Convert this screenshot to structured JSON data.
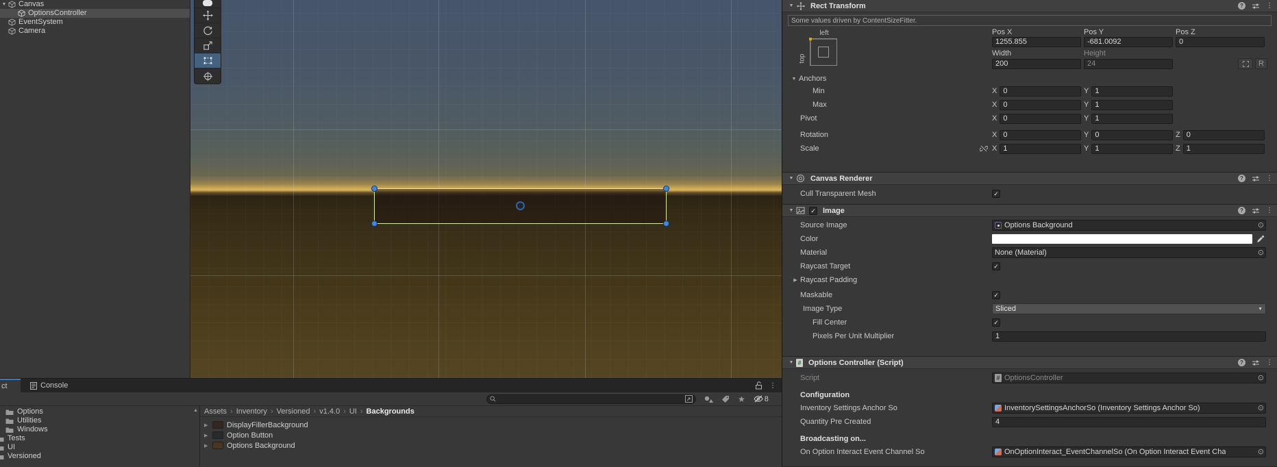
{
  "hierarchy": {
    "items": [
      {
        "label": "Canvas"
      },
      {
        "label": "OptionsController"
      },
      {
        "label": "EventSystem"
      },
      {
        "label": "Camera"
      }
    ]
  },
  "inspector": {
    "axis": {
      "x": "X",
      "y": "Y",
      "z": "Z"
    },
    "rect_transform": {
      "title": "Rect Transform",
      "info": "Some values driven by ContentSizeFitter.",
      "anchor_h": "left",
      "anchor_v": "top",
      "pos_x_label": "Pos X",
      "pos_x": "1255.855",
      "pos_y_label": "Pos Y",
      "pos_y": "-681.0092",
      "pos_z_label": "Pos Z",
      "pos_z": "0",
      "width_label": "Width",
      "width": "200",
      "height_label": "Height",
      "height": "24",
      "raw_button": "R",
      "anchors_label": "Anchors",
      "min_label": "Min",
      "min_x": "0",
      "min_y": "1",
      "max_label": "Max",
      "max_x": "0",
      "max_y": "1",
      "pivot_label": "Pivot",
      "pivot_x": "0",
      "pivot_y": "1",
      "rotation_label": "Rotation",
      "rotation_x": "0",
      "rotation_y": "0",
      "rotation_z": "0",
      "scale_label": "Scale",
      "scale_x": "1",
      "scale_y": "1",
      "scale_z": "1"
    },
    "canvas_renderer": {
      "title": "Canvas Renderer",
      "cull_label": "Cull Transparent Mesh"
    },
    "image": {
      "title": "Image",
      "source_label": "Source Image",
      "source_value": "Options Background",
      "color_label": "Color",
      "material_label": "Material",
      "material_value": "None (Material)",
      "raycast_target_label": "Raycast Target",
      "raycast_padding_label": "Raycast Padding",
      "maskable_label": "Maskable",
      "type_label": "Image Type",
      "type_value": "Sliced",
      "fill_center_label": "Fill Center",
      "ppu_label": "Pixels Per Unit Multiplier",
      "ppu_value": "1"
    },
    "options_controller": {
      "title": "Options Controller (Script)",
      "script_label": "Script",
      "script_value": "OptionsController",
      "config_header": "Configuration",
      "anchor_so_label": "Inventory Settings Anchor So",
      "anchor_so_value": "InventorySettingsAnchorSo (Inventory Settings Anchor So)",
      "quantity_label": "Quantity Pre Created",
      "quantity_value": "4",
      "broadcast_header": "Broadcasting on...",
      "event_label": "On Option Interact Event Channel So",
      "event_value": "OnOptionInteract_EventChannelSo (On Option Interact Event Cha"
    }
  },
  "bottom_panel": {
    "tab_partial": "ct",
    "tab_console": "Console",
    "hidden_count": "8",
    "breadcrumb_sep": "›",
    "folders": [
      "Options",
      "Utilities",
      "Windows",
      "Tests",
      "UI",
      "Versioned"
    ],
    "breadcrumb": [
      "Assets",
      "Inventory",
      "Versioned",
      "v1.4.0",
      "UI",
      "Backgrounds"
    ],
    "assets": [
      {
        "name": "DisplayFillerBackground",
        "color": "#362620"
      },
      {
        "name": "Option Button",
        "color": "#2a2a2a"
      },
      {
        "name": "Options Background",
        "color": "#483524"
      }
    ]
  },
  "colors": {
    "selection_bg": "#4d4d4d",
    "tab_accent": "#3c78c8",
    "horizon_gold": "#d9b45a",
    "selection_rect_border": "#d6f0a2",
    "handle_blue": "#3f87e6",
    "field_bg": "#2a2a2a"
  }
}
